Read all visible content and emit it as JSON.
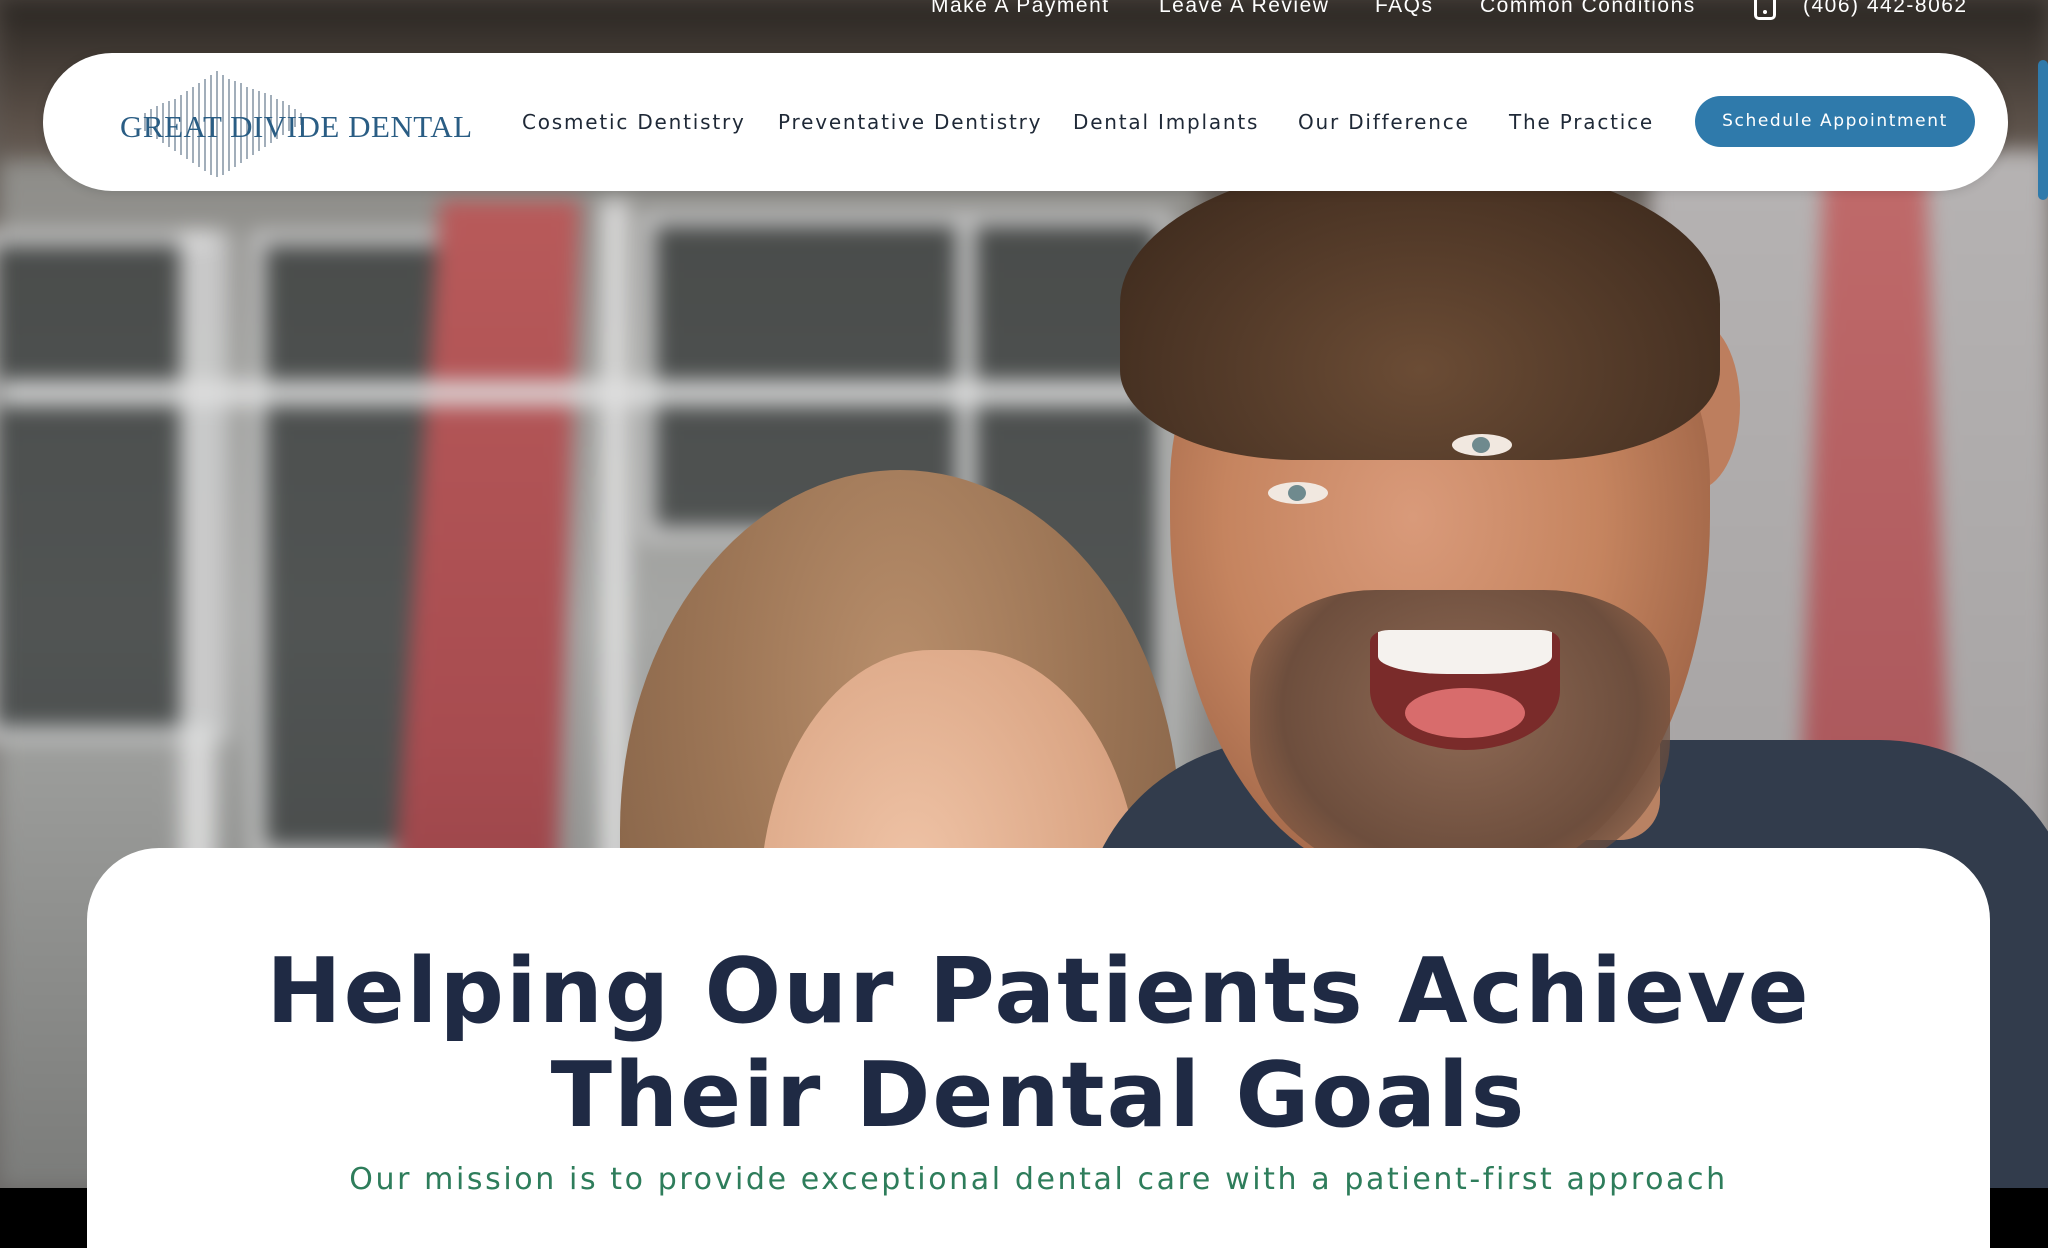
{
  "utility_bar": {
    "links": [
      {
        "label": "Make A Payment"
      },
      {
        "label": "Leave A Review"
      },
      {
        "label": "FAQs"
      },
      {
        "label": "Common Conditions"
      }
    ],
    "phone": "(406) 442-8062",
    "phone_icon": "smartphone-icon"
  },
  "nav": {
    "logo_text": "GREAT DIVIDE DENTAL",
    "links": [
      {
        "label": "Cosmetic Dentistry"
      },
      {
        "label": "Preventative Dentistry"
      },
      {
        "label": "Dental Implants"
      },
      {
        "label": "Our Difference"
      },
      {
        "label": "The Practice"
      }
    ],
    "cta_label": "Schedule Appointment"
  },
  "hero": {
    "headline_line1": "Helping Our Patients Achieve",
    "headline_line2": "Their Dental Goals",
    "subline": "Our mission is to provide exceptional dental care with a patient-first approach"
  },
  "colors": {
    "brand_blue": "#2f7aab",
    "logo_blue": "#2a5d84",
    "headline_navy": "#1f2a44",
    "subline_green": "#2e7d5b"
  }
}
